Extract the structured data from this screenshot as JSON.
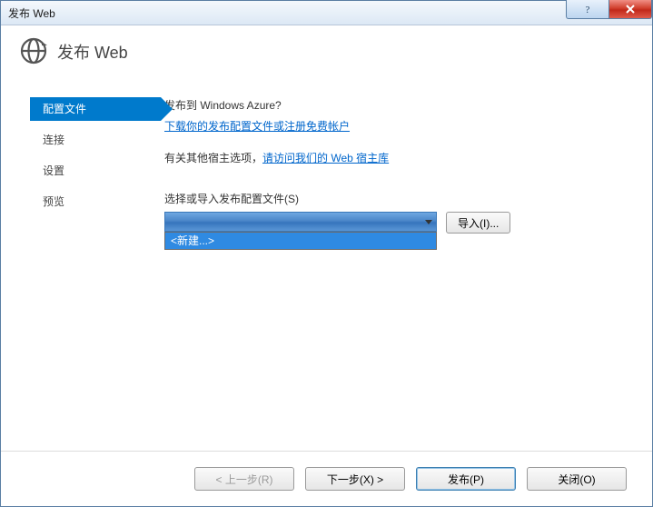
{
  "window": {
    "title": "发布 Web"
  },
  "header": {
    "title": "发布 Web"
  },
  "sidebar": {
    "items": [
      {
        "label": "配置文件",
        "active": true
      },
      {
        "label": "连接"
      },
      {
        "label": "设置"
      },
      {
        "label": "预览"
      }
    ]
  },
  "main": {
    "azure_heading": "发布到 Windows Azure?",
    "download_link": "下载你的发布配置文件或注册免费帐户",
    "other_hosts_prefix": "有关其他宿主选项，",
    "other_hosts_link": "请访问我们的 Web 宿主库",
    "profile_label": "选择或导入发布配置文件(S)",
    "combo_selected": "",
    "combo_option_new": "<新建...>",
    "import_button": "导入(I)..."
  },
  "footer": {
    "prev": "< 上一步(R)",
    "next": "下一步(X) >",
    "publish": "发布(P)",
    "close": "关闭(O)"
  }
}
